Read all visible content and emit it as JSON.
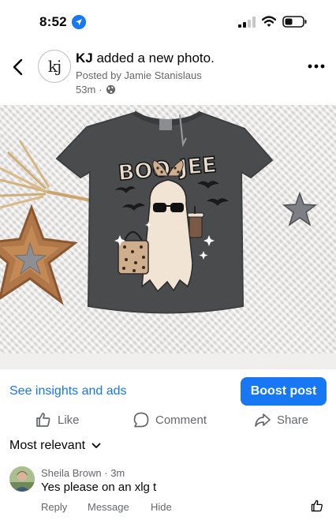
{
  "status_bar": {
    "time": "8:52",
    "icons": [
      "location-arrow-icon",
      "cell-signal-icon",
      "wifi-icon",
      "battery-icon"
    ]
  },
  "post": {
    "page_name": "KJ",
    "action_text": " added a new photo.",
    "avatar_text": "kj",
    "posted_by": "Posted by Jamie Stanislaus",
    "time_ago": "53m",
    "separator": "·",
    "audience_icon": "globe-icon"
  },
  "photo": {
    "shirt_text": "BOO-JEE",
    "colors": {
      "shirt": "#4a4b4d",
      "background": "#e9e8e6",
      "ghost": "#f1e4d4",
      "leopard": "#cfae8e"
    }
  },
  "insights": {
    "link": "See insights and ads",
    "boost": "Boost post"
  },
  "actions": {
    "like": "Like",
    "comment": "Comment",
    "share": "Share"
  },
  "comments": {
    "sort_label": "Most relevant",
    "items": [
      {
        "author": "Sheila Brown",
        "separator": "·",
        "time": "3m",
        "text": "Yes please on an xlg t",
        "actions": {
          "reply": "Reply",
          "message": "Message",
          "hide": "Hide"
        }
      }
    ]
  },
  "colors": {
    "accent": "#1877f2",
    "secondary_text": "#65676b",
    "primary_text": "#050505"
  }
}
